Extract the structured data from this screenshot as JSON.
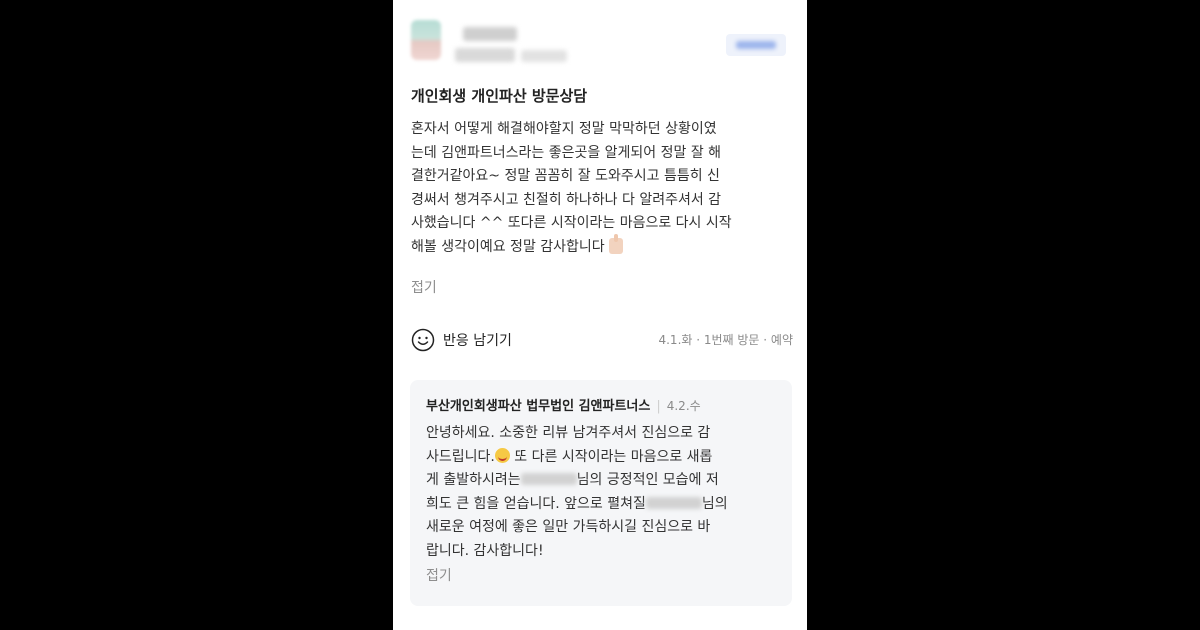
{
  "title": "개인회생 개인파산 방문상담",
  "review_lines": [
    "혼자서 어떻게 해결해야할지 정말 막막하던 상황이였",
    "는데 김앤파트너스라는 좋은곳을 알게되어 정말 잘 해",
    "결한거같아요~ 정말 꼼꼼히 잘 도와주시고 틈틈히 신",
    "경써서 챙겨주시고 친절히 하나하나 다 알려주셔서 감",
    "사했습니다 ^^ 또다른 시작이라는 마음으로 다시 시작",
    "해볼 생각이예요 정말 감사합니다"
  ],
  "fold_label": "접기",
  "react_label": "반응 남기기",
  "visit_meta": "4.1.화 · 1번째 방문 · 예약",
  "reply": {
    "owner": "부산개인회생파산 법무법인 김앤파트너스",
    "date": "4.2.수",
    "line1": "안녕하세요. 소중한 리뷰 남겨주셔서 진심으로 감",
    "line2a": "사드립니다.",
    "line2b": " 또 다른 시작이라는 마음으로 새롭",
    "line3a": "게 출발하시려는",
    "line3b": "님의 긍정적인 모습에 저",
    "line4a": "희도 큰 힘을 얻습니다. 앞으로 펼쳐질",
    "line4b": "님의",
    "line5": "새로운 여정에 좋은 일만 가득하시길 진심으로 바",
    "line6": "랍니다. 감사합니다!",
    "fold_label": "접기"
  },
  "icons": {
    "react": "smile-icon",
    "thumb": "thumbs-up-emoji",
    "reply_emoji": "smiling-face-emoji"
  }
}
